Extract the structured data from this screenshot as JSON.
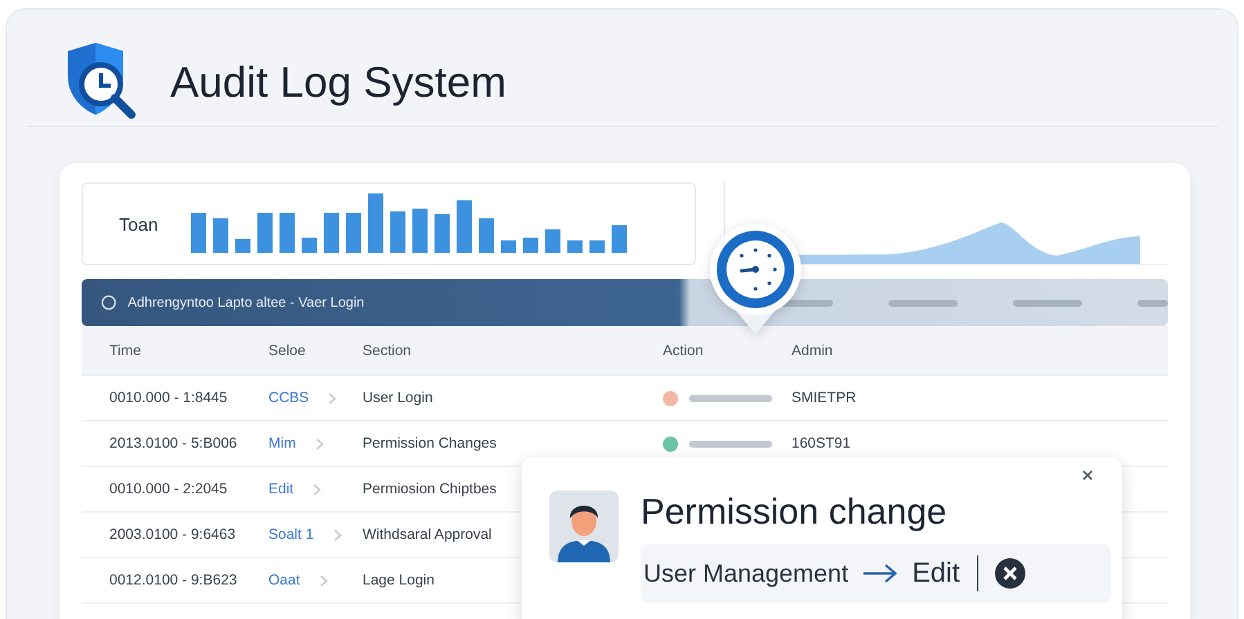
{
  "app": {
    "title": "Audit Log System"
  },
  "chart": {
    "label": "Toan"
  },
  "banner": {
    "text": "Adhrengyntoo Lapto altee - Vaer Login"
  },
  "table": {
    "columns": [
      "Time",
      "Seloe",
      "Section",
      "Action",
      "Admin"
    ],
    "rows": [
      {
        "time": "0010.000 - 1:8445",
        "source": "CCBS",
        "section": "User Login",
        "color": "#f2b9a2",
        "admin": "SMIETPR"
      },
      {
        "time": "2013.0100 - 5:B006",
        "source": "Mim",
        "section": "Permission Changes",
        "color": "#6cc4a8",
        "admin": "160ST91"
      },
      {
        "time": "0010.000 - 2:2045",
        "source": "Edit",
        "section": "Permiosion Chiptbes"
      },
      {
        "time": "2003.0100 - 9:6463",
        "source": "Soalt 1",
        "section": "Withdsaral Approval"
      },
      {
        "time": "0012.0100 - 9:B623",
        "source": "Oaat",
        "section": "Lage Login"
      }
    ]
  },
  "popup": {
    "title": "Permission change",
    "path": "User Management",
    "target": "Edit"
  }
}
